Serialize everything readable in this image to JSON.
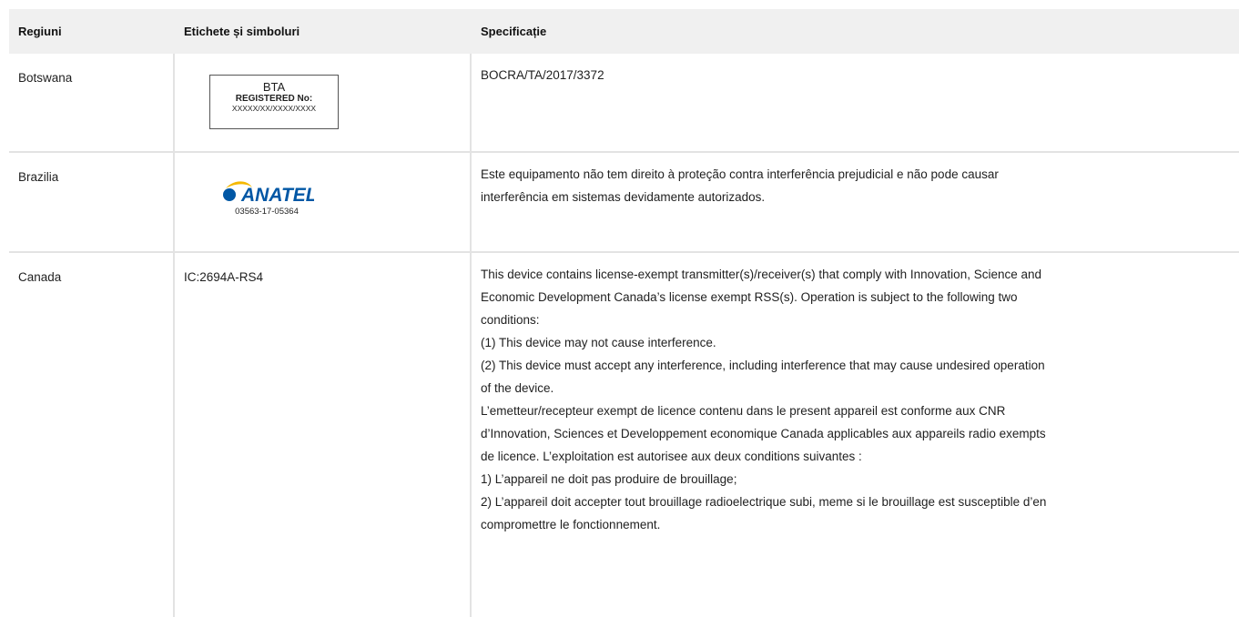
{
  "columns": [
    "Regiuni",
    "Etichete și simboluri",
    "Specificație"
  ],
  "colors": {
    "header_bg": "#f0f0f0",
    "grid": "#e3e3e3",
    "anatel_blue": "#0057a5",
    "anatel_yellow": "#f5b800"
  },
  "rows": [
    {
      "region": "Botswana",
      "label": {
        "type": "bta-box",
        "title": "BTA",
        "registered": "REGISTERED No:",
        "number": "XXXXX/XX/XXXX/XXXX"
      },
      "spec": "BOCRA/TA/2017/3372"
    },
    {
      "region": "Brazilia",
      "label": {
        "type": "anatel-logo",
        "logo_text": "ANATEL",
        "number": "03563-17-05364"
      },
      "spec": "Este equipamento não tem direito à proteção contra interferência prejudicial e não pode causar\ninterferência em sistemas devidamente autorizados."
    },
    {
      "region": "Canada",
      "label": {
        "type": "text",
        "text": "IC:2694A-RS4"
      },
      "spec": "This device contains license-exempt transmitter(s)/receiver(s) that comply with Innovation, Science and\nEconomic Development Canada’s license exempt RSS(s). Operation is subject to the following two\nconditions:\n(1) This device may not cause interference.\n(2) This device must accept any interference, including interference that may cause undesired operation\nof the device.\nL’emetteur/recepteur exempt de licence contenu dans le present appareil est conforme aux CNR\nd’Innovation, Sciences et Developpement economique Canada applicables aux appareils radio exempts\nde licence. L’exploitation est autorisee aux deux conditions suivantes :\n1) L’appareil ne doit pas produire de brouillage;\n2) L’appareil doit accepter tout brouillage radioelectrique subi, meme si le brouillage est susceptible d’en\ncompromettre le fonctionnement."
    }
  ]
}
